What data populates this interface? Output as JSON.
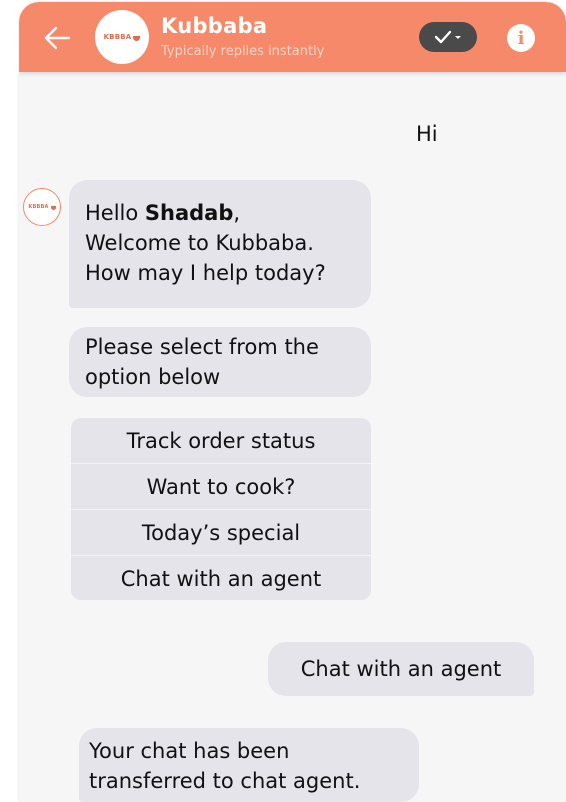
{
  "header": {
    "title": "Kubbaba",
    "subtitle": "Typically replies instantly",
    "logo_text": "KBBBA"
  },
  "colors": {
    "header_bg": "#f5896a",
    "bubble_bg": "#e4e4ea",
    "chat_bg": "#f6f6f6"
  },
  "icons": {
    "back": "back-arrow-icon",
    "resolve": "checkmark-dropdown-icon",
    "info": "info-icon"
  },
  "messages": {
    "user_hi": "Hi",
    "greeting_hello": "Hello ",
    "greeting_name": "Shadab",
    "greeting_comma": ",",
    "greeting_line2": "Welcome to Kubbaba.",
    "greeting_line3": "How may I help today?",
    "select_line1": "Please select from the",
    "select_line2": "option below",
    "user_choice": "Chat with an agent",
    "transfer_line1": "Your chat has been",
    "transfer_line2": "transferred to chat agent."
  },
  "options": [
    "Track order status",
    "Want to cook?",
    "Today’s special",
    "Chat with an agent"
  ]
}
